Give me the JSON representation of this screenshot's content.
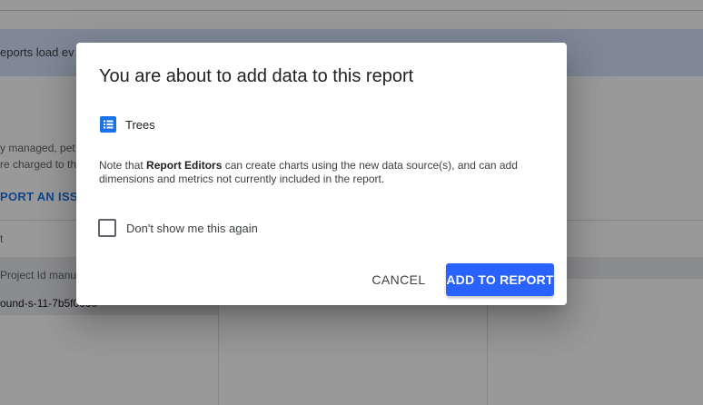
{
  "background": {
    "banner_text": "eports load ev",
    "line1": "y managed, pet",
    "line2": "re charged to th",
    "report_issue_link": "PORT AN ISSU",
    "table_header": "t",
    "row_label": "Project Id manu",
    "row_value": "ound-s-11-7b5f0000"
  },
  "dialog": {
    "title": "You are about to add data to this report",
    "data_source": {
      "name": "Trees",
      "icon": "list-icon"
    },
    "note": {
      "prefix": "Note that ",
      "emphasis": "Report Editors",
      "suffix": " can create charts using the new data source(s), and can add dimensions and metrics not currently included in the report."
    },
    "checkbox": {
      "label": "Don't show me this again",
      "checked": false
    },
    "cancel_label": "CANCEL",
    "add_label": "ADD TO REPORT"
  },
  "colors": {
    "accent": "#2962ff",
    "icon_blue": "#1a73e8",
    "banner": "#d2e3fc"
  }
}
